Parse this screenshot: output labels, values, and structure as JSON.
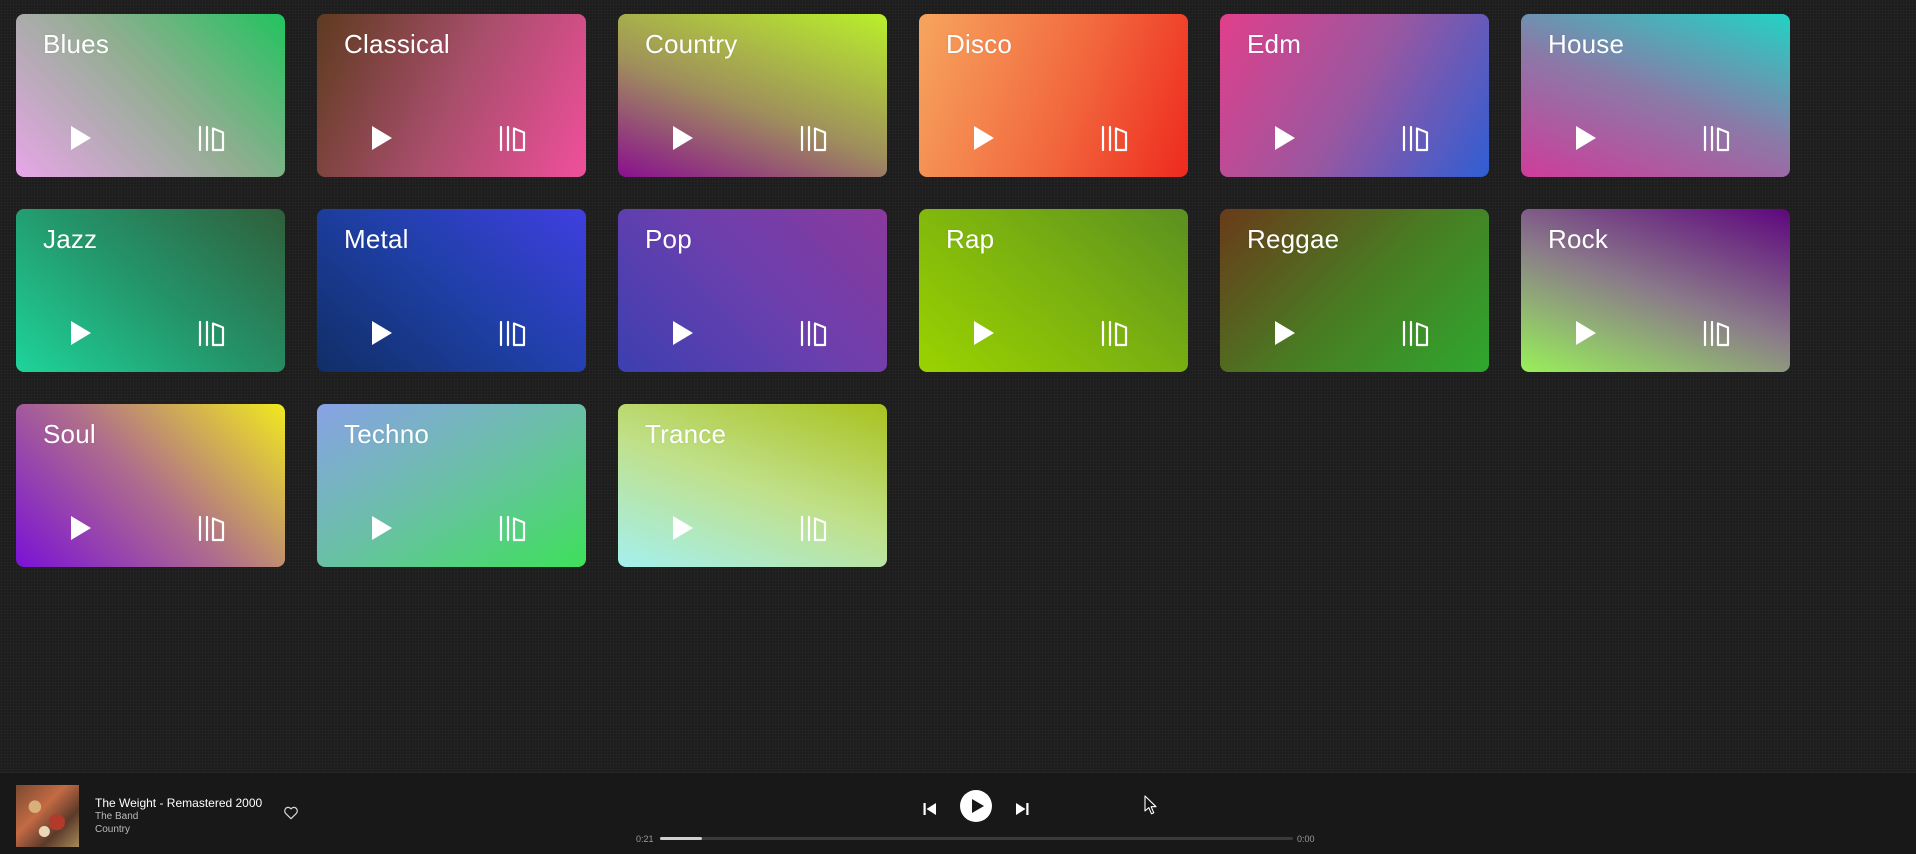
{
  "genres": [
    {
      "label": "Blues",
      "class": "g-blues"
    },
    {
      "label": "Classical",
      "class": "g-classical"
    },
    {
      "label": "Country",
      "class": "g-country"
    },
    {
      "label": "Disco",
      "class": "g-disco"
    },
    {
      "label": "Edm",
      "class": "g-edm"
    },
    {
      "label": "House",
      "class": "g-house"
    },
    {
      "label": "Jazz",
      "class": "g-jazz"
    },
    {
      "label": "Metal",
      "class": "g-metal"
    },
    {
      "label": "Pop",
      "class": "g-pop"
    },
    {
      "label": "Rap",
      "class": "g-rap"
    },
    {
      "label": "Reggae",
      "class": "g-reggae"
    },
    {
      "label": "Rock",
      "class": "g-rock"
    },
    {
      "label": "Soul",
      "class": "g-soul"
    },
    {
      "label": "Techno",
      "class": "g-techno"
    },
    {
      "label": "Trance",
      "class": "g-trance"
    }
  ],
  "card_icons": {
    "play": "play-icon",
    "library": "library-icon"
  },
  "player": {
    "track_title": "The Weight - Remastered 2000",
    "artist": "The Band",
    "genre": "Country",
    "time_elapsed": "0:21",
    "time_total": "0:00",
    "progress_fraction": 0.066,
    "icons": {
      "favorite": "heart-icon",
      "previous": "skip-previous-icon",
      "play": "play-circle-icon",
      "next": "skip-next-icon"
    }
  },
  "colors": {
    "background": "#1d1d1d",
    "player_background": "#181818",
    "text_primary": "#ffffff",
    "text_secondary": "#bbbbbb"
  }
}
